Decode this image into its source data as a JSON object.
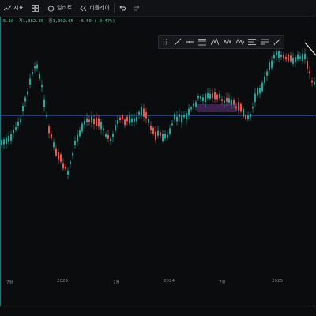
{
  "toolbar": {
    "indicators_label": "지표",
    "alerts_label": "얼러트",
    "replay_label": "리플레이"
  },
  "ohlc": {
    "open_partial": "5.10",
    "high_label": "저",
    "high_value": "1,382.80",
    "close_label": "종",
    "close_value": "1,392.65",
    "change": "-6.50 (-0.47%)"
  },
  "xaxis": {
    "ticks": [
      "7월",
      "2023",
      "7월",
      "2024",
      "7월",
      "2025"
    ]
  },
  "colors": {
    "up": "#26a69a",
    "down": "#ef5350",
    "hline": "#3d6fd1",
    "highlight": "#7a3fa0"
  },
  "chart_data": {
    "type": "candlestick",
    "x_ticks": [
      "7월",
      "2023",
      "7월",
      "2024",
      "7월",
      "2025"
    ],
    "horizontal_line": true
  }
}
